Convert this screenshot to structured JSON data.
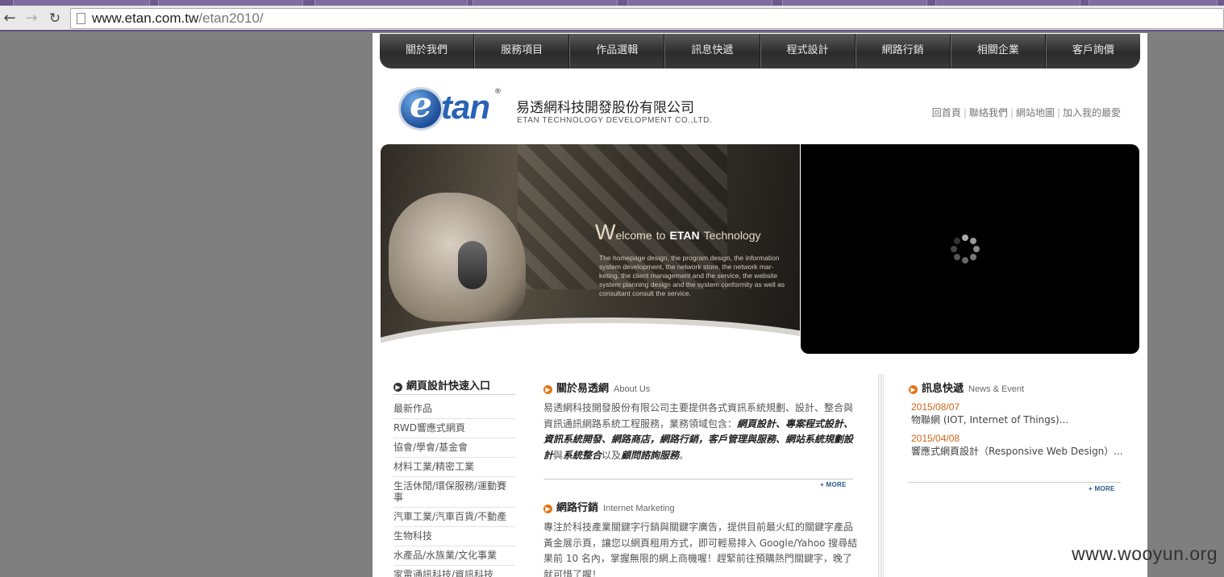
{
  "browser": {
    "url_host": "www.etan.com.tw",
    "url_path": "/etan2010/"
  },
  "topnav": {
    "items": [
      "關於我們",
      "服務項目",
      "作品選輯",
      "訊息快遞",
      "程式設計",
      "網路行銷",
      "相關企業",
      "客戶詢價"
    ]
  },
  "header": {
    "logo_e": "e",
    "logo_text": "tan",
    "logo_mark": "®",
    "company_zh": "易透網科技開發股份有限公司",
    "company_en": "ETAN TECHNOLOGY DEVELOPMENT CO.,LTD.",
    "links": [
      "回首頁",
      "聯絡我們",
      "網站地圖",
      "加入我的最愛"
    ]
  },
  "banner": {
    "welcome_big": "W",
    "welcome_rest": "elcome",
    "welcome_to": "to",
    "welcome_brand": "ETAN",
    "welcome_tech": "Technology",
    "body": "The homepage design, the program design, the information system development, the network store, the network mar-keting, the client management and the service, the website system planning design and the system conformity as well as consultant consult the service."
  },
  "quick": {
    "title": "網頁設計快速入口",
    "items": [
      "最新作品",
      "RWD響應式網頁",
      "協會/學會/基金會",
      "材料工業/精密工業",
      "生活休閒/環保服務/運動賽事",
      "汽車工業/汽車百貨/不動產",
      "生物科技",
      "水產品/水族業/文化事業",
      "家電通訊科技/資訊科技"
    ]
  },
  "about": {
    "title_zh": "關於易透網",
    "title_en": "About Us",
    "text_lead": "易透網科技開發股份有限公司主要提供各式資訊系統規劃、設計、整合與資訊通訊網路系統工程服務，業務領域包含：",
    "text_em1": "網頁設計、專案程式設計、資訊系統開發、網路商店，網路行銷，客戶管理與服務、網站系統規劃設計",
    "text_mid": "與",
    "text_em2": "系統整合",
    "text_mid2": "以及",
    "text_em3": "顧問諮詢服務",
    "text_end": "。",
    "more": "+ MORE"
  },
  "marketing": {
    "title_zh": "網路行銷",
    "title_en": "Internet Marketing",
    "text": "專注於科技產業關鍵字行銷與關鍵字廣告，提供目前最火紅的關鍵字產品黃金展示頁，讓您以網頁租用方式，即可輕易排入 Google/Yahoo 搜尋結果前 10 名內，掌握無限的網上商機喔！趕緊前往預購熱門關鍵字，晚了就可惜了喔！"
  },
  "news": {
    "title_zh": "訊息快遞",
    "title_en": "News & Event",
    "items": [
      {
        "date": "2015/08/07",
        "title": "物聯網 (IOT, Internet of Things)..."
      },
      {
        "date": "2015/04/08",
        "title": "響應式網頁設計（Responsive Web Design）..."
      }
    ],
    "more": "+ MORE"
  },
  "watermark": "www.wooyun.org"
}
